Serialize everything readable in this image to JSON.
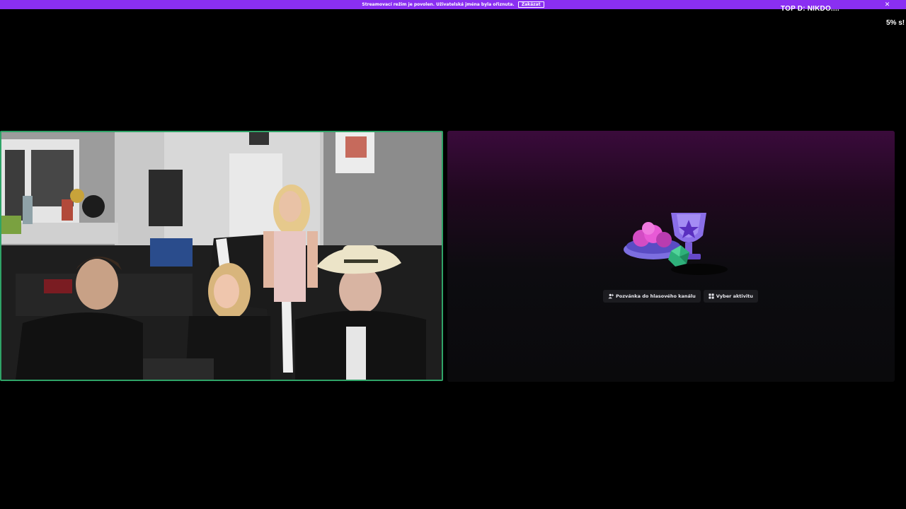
{
  "notice": {
    "text": "Streamovací režim je povolen. Uživatelská jména byla ořiznuta.",
    "button_label": "Zakázat",
    "close_glyph": "✕",
    "color": "#8a2ff2"
  },
  "overlay": {
    "top_donor": "TOP D: NIKDO....",
    "percent": "5% s!"
  },
  "video": {
    "border_color": "#2fa367"
  },
  "activity": {
    "invite_label": "Pozvánka do hlasového kanálu",
    "invite_icon": "person-add-icon",
    "choose_label": "Vyber aktivitu",
    "choose_icon": "apps-icon"
  }
}
